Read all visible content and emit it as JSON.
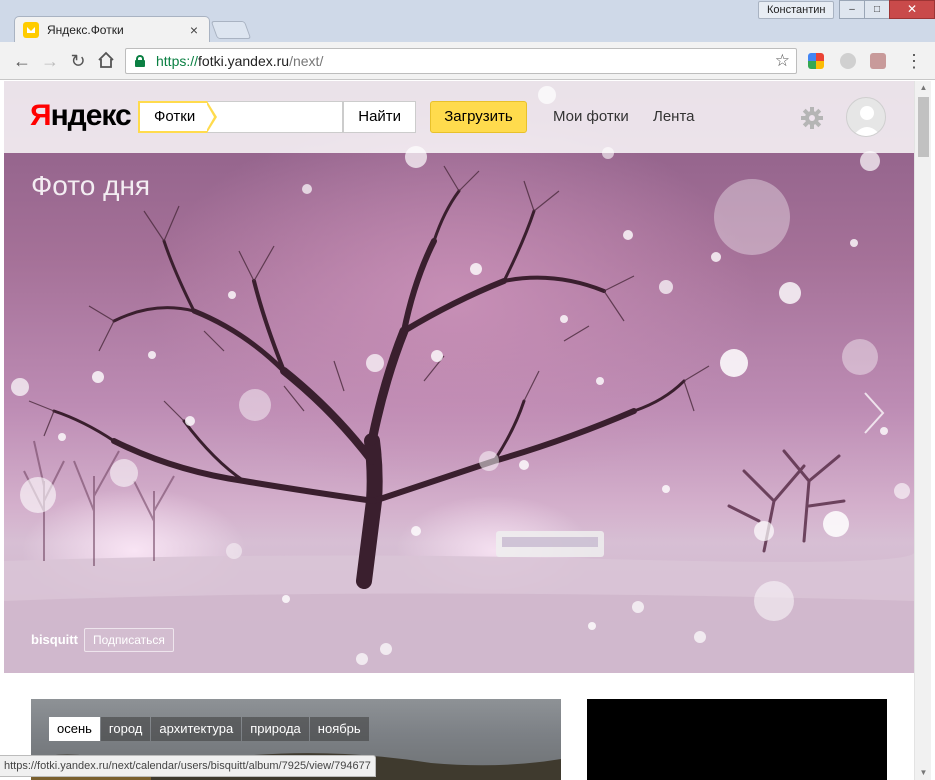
{
  "browser": {
    "tab_title": "Яндекс.Фотки",
    "user_name": "Константин",
    "url_scheme": "https://",
    "url_host": "fotki.yandex.ru",
    "url_path": "/next/",
    "status_url": "https://fotki.yandex.ru/next/calendar/users/bisquitt/album/7925/view/794677"
  },
  "header": {
    "logo_first": "Я",
    "logo_rest": "ндекс",
    "service_tag": "Фотки",
    "search_button": "Найти",
    "upload_button": "Загрузить",
    "nav_my_photos": "Мои фотки",
    "nav_feed": "Лента",
    "icons": [
      "gear-icon",
      "avatar"
    ]
  },
  "hero": {
    "title": "Фото дня",
    "author": "bisquitt",
    "subscribe_button": "Подписаться"
  },
  "album": {
    "tags": [
      "осень",
      "город",
      "архитектура",
      "природа",
      "ноябрь"
    ],
    "active_tag_index": 0
  },
  "colors": {
    "accent_yellow": "#ffdb4d",
    "secure_green": "#0b8043",
    "hero_pink": "#bd8cb4"
  }
}
